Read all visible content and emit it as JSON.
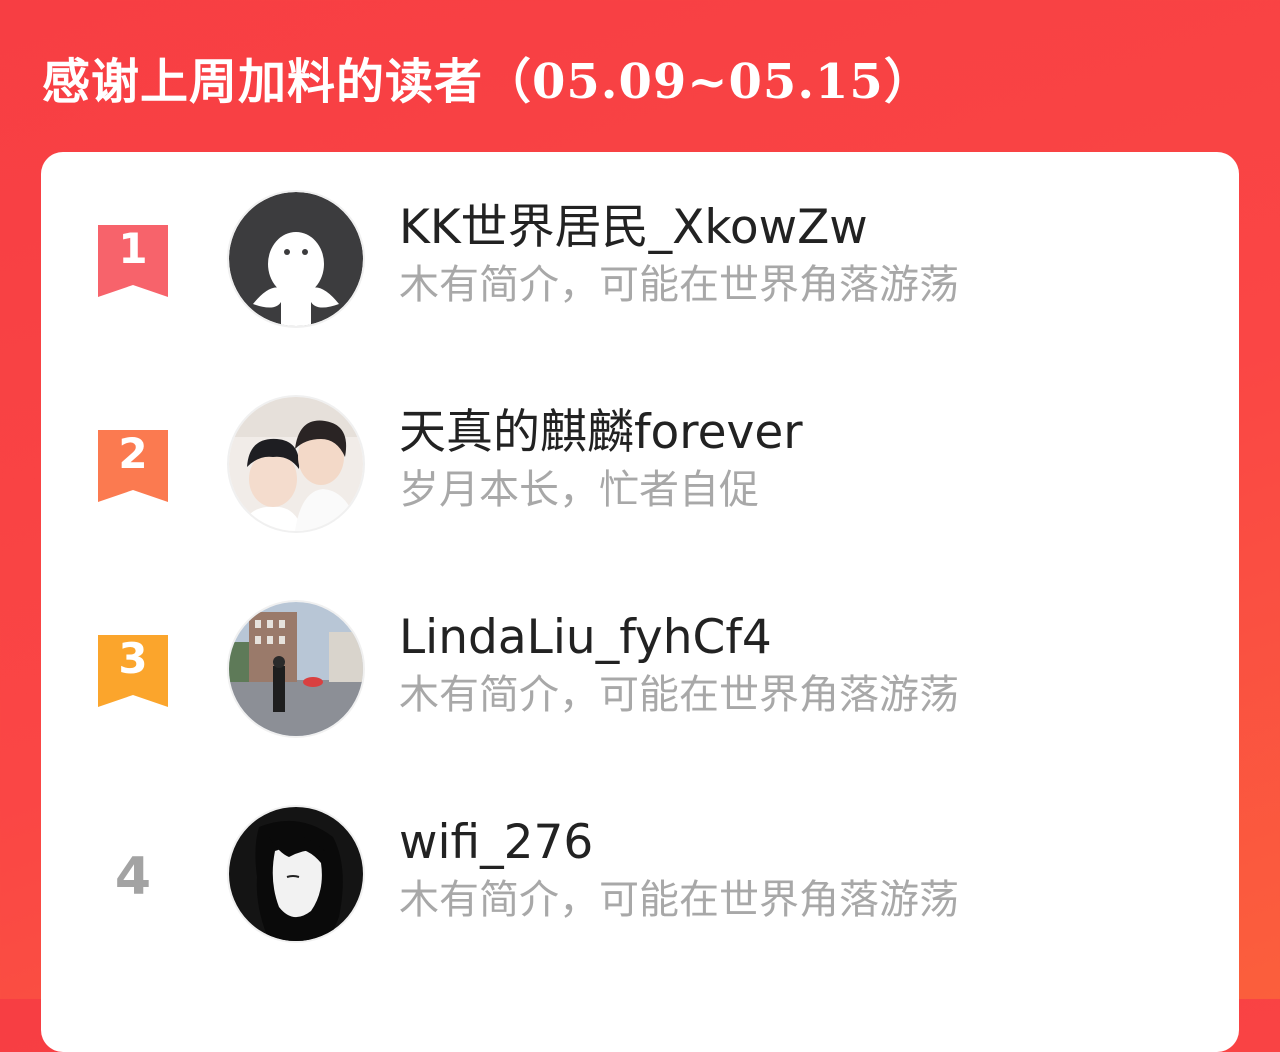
{
  "header": {
    "title": "感谢上周加料的读者（05.09~05.15）"
  },
  "colors": {
    "background": "#f94444",
    "rank1": "#f7636b",
    "rank2": "#fb7a50",
    "rank3": "#fba52c",
    "rank_plain": "#a3a3a3",
    "name": "#222222",
    "bio": "#a8a8a8"
  },
  "readers": [
    {
      "rank": "1",
      "name": "KK世界居民_XkowZw",
      "bio": "木有简介，可能在世界角落游荡",
      "avatar": "default-ghost-avatar"
    },
    {
      "rank": "2",
      "name": "天真的麒麟forever",
      "bio": "岁月本长，忙者自促",
      "avatar": "anime-couple-avatar"
    },
    {
      "rank": "3",
      "name": "LindaLiu_fyhCf4",
      "bio": "木有简介，可能在世界角落游荡",
      "avatar": "street-photo-avatar"
    },
    {
      "rank": "4",
      "name": "wifi_276",
      "bio": "木有简介，可能在世界角落游荡",
      "avatar": "dark-anime-avatar"
    }
  ]
}
